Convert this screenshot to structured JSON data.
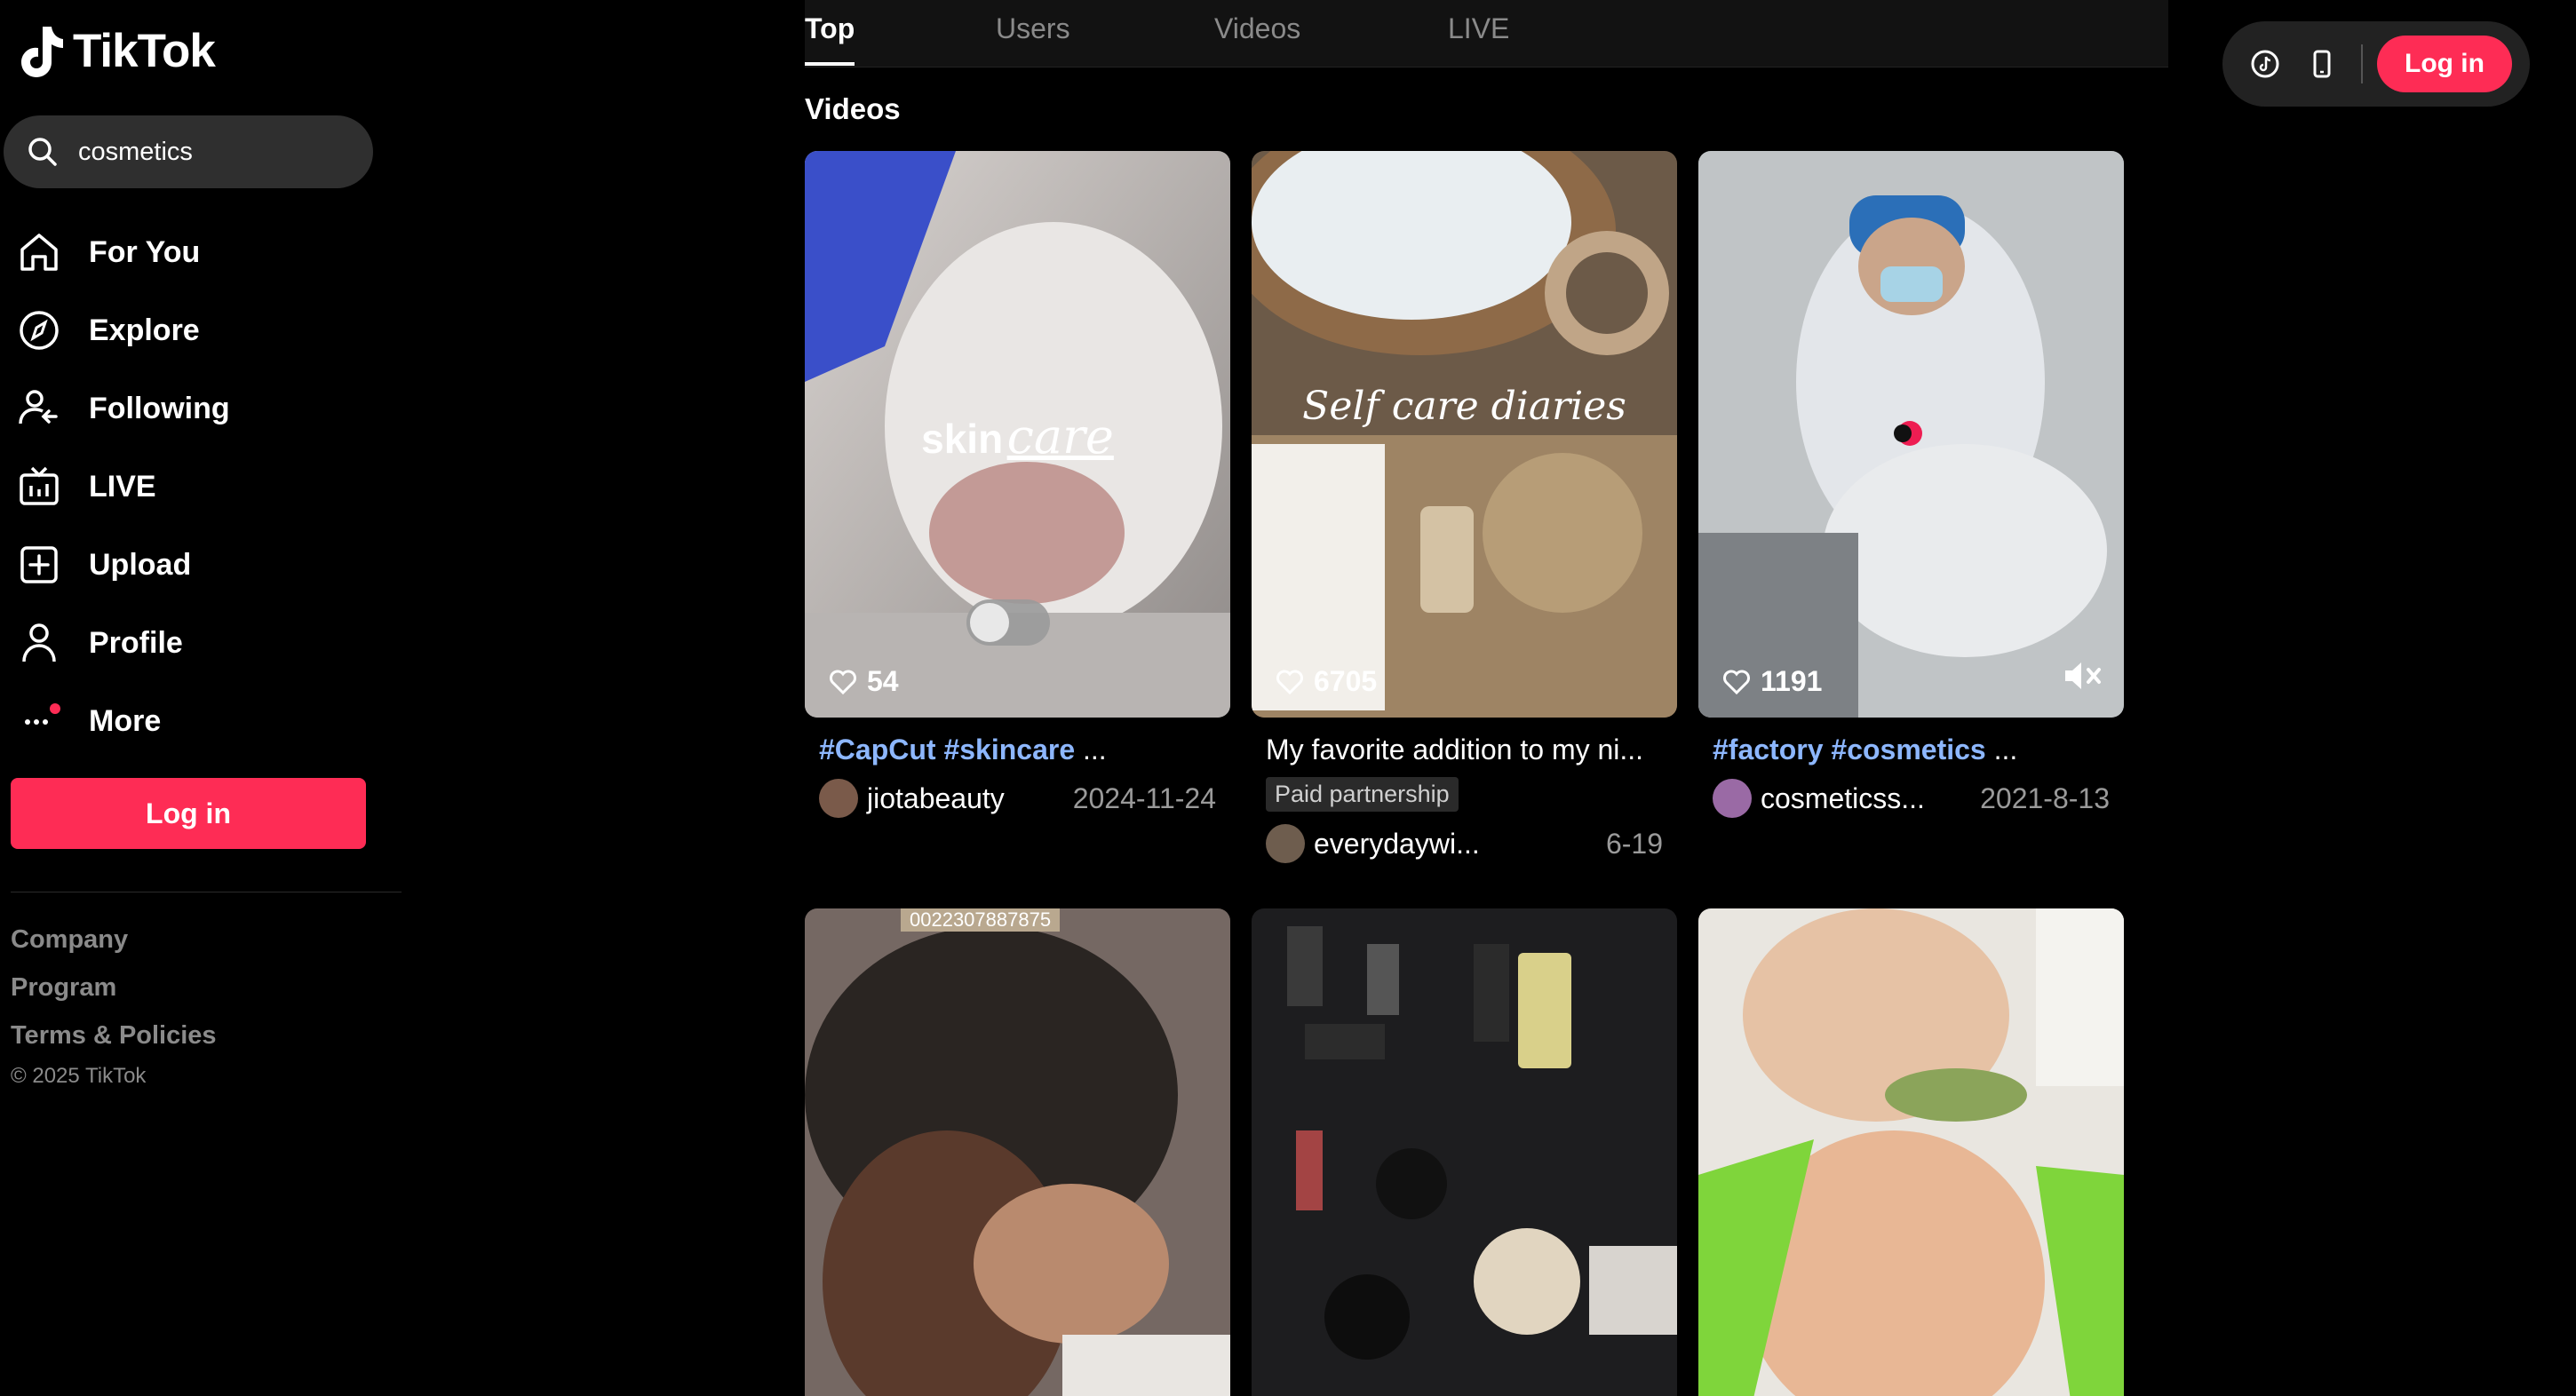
{
  "app": {
    "name": "TikTok"
  },
  "search": {
    "value": "cosmetics",
    "placeholder": "Search"
  },
  "nav": [
    {
      "label": "For You",
      "icon": "home-icon"
    },
    {
      "label": "Explore",
      "icon": "compass-icon"
    },
    {
      "label": "Following",
      "icon": "following-icon"
    },
    {
      "label": "LIVE",
      "icon": "live-tv-icon"
    },
    {
      "label": "Upload",
      "icon": "upload-plus-icon"
    },
    {
      "label": "Profile",
      "icon": "person-icon"
    },
    {
      "label": "More",
      "icon": "more-dots-icon"
    }
  ],
  "sidebar_login": "Log in",
  "footer": {
    "links": [
      "Company",
      "Program",
      "Terms & Policies"
    ],
    "copyright": "© 2025 TikTok"
  },
  "tabs": [
    "Top",
    "Users",
    "Videos",
    "LIVE"
  ],
  "section_title": "Videos",
  "header": {
    "login": "Log in"
  },
  "videos": [
    {
      "overlay_bold": "skin",
      "overlay_script": "care",
      "likes": "54",
      "tags": "#CapCut #skincare",
      "desc_rest": " ...",
      "user": "jiotabeauty",
      "date": "2024-11-24"
    },
    {
      "overlay_script": "Self care diaries",
      "likes": "6705",
      "desc": "My favorite addition to my ni...",
      "badge": "Paid partnership",
      "user": "everydaywi...",
      "date": "6-19"
    },
    {
      "likes": "1191",
      "tags": "#factory #cosmetics",
      "desc_rest": " ...",
      "user": "cosmeticss...",
      "date": "2021-8-13"
    },
    {
      "overlay_top": "0022307887875"
    },
    {},
    {}
  ],
  "colors": {
    "accent": "#fe2c55",
    "hashtag": "#8db7ff"
  }
}
